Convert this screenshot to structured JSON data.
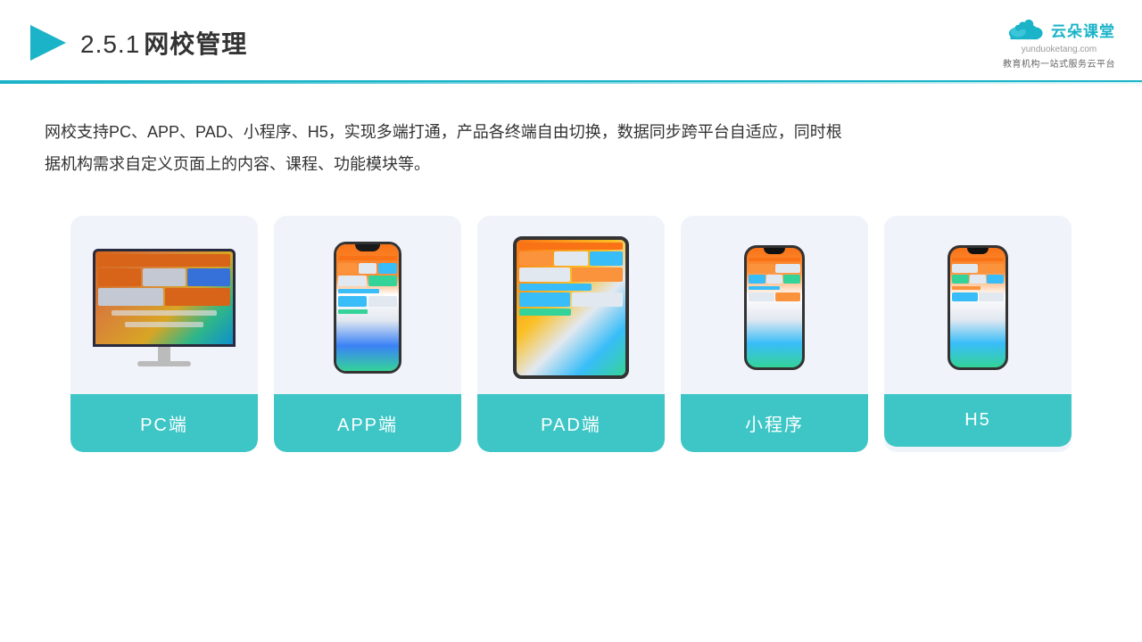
{
  "header": {
    "title_num": "2.5.1",
    "title_text": "网校管理",
    "logo_main": "云朵课堂",
    "logo_url": "yunduoketang.com",
    "logo_tagline": "教育机构一站式服务云平台"
  },
  "description": {
    "text": "网校支持PC、APP、PAD、小程序、H5，实现多端打通，产品各终端自由切换，数据同步跨平台自适应，同时根据机构需求自定义页面上的内容、课程、功能模块等。"
  },
  "cards": [
    {
      "id": "pc",
      "label": "PC端"
    },
    {
      "id": "app",
      "label": "APP端"
    },
    {
      "id": "pad",
      "label": "PAD端"
    },
    {
      "id": "miniprogram",
      "label": "小程序"
    },
    {
      "id": "h5",
      "label": "H5"
    }
  ]
}
